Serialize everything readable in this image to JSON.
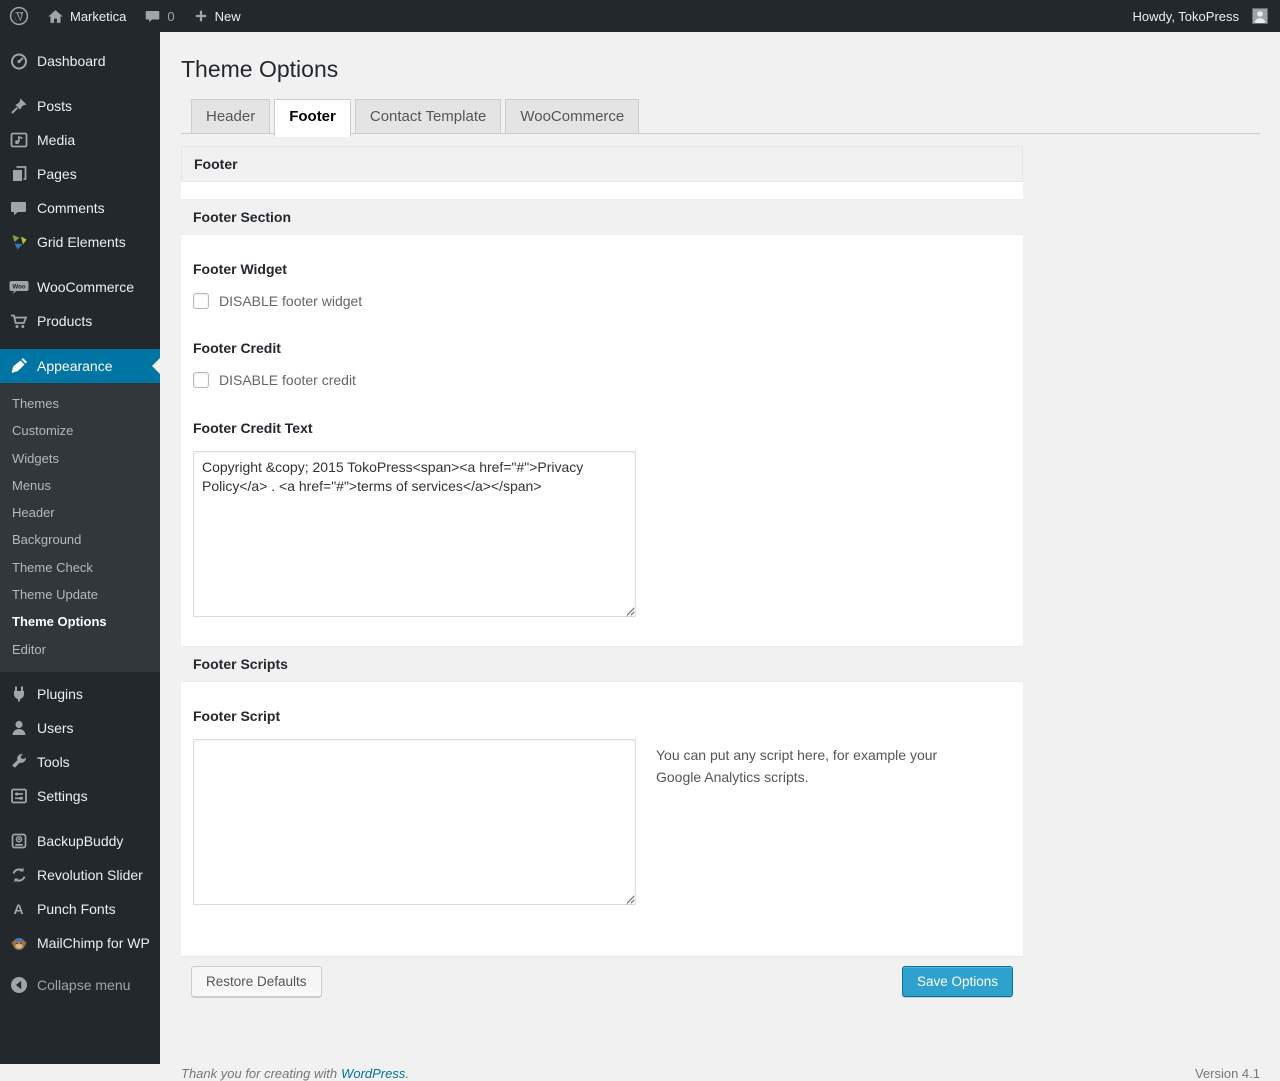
{
  "admin_bar": {
    "site_name": "Marketica",
    "comment_count": "0",
    "new_label": "New",
    "howdy_text": "Howdy, TokoPress"
  },
  "sidebar": {
    "items": [
      {
        "label": "Dashboard",
        "icon": "dashboard-icon"
      },
      {
        "label": "Posts",
        "icon": "pin-icon"
      },
      {
        "label": "Media",
        "icon": "media-icon"
      },
      {
        "label": "Pages",
        "icon": "pages-icon"
      },
      {
        "label": "Comments",
        "icon": "comments-icon"
      },
      {
        "label": "Grid Elements",
        "icon": "grid-elements-icon"
      },
      {
        "label": "WooCommerce",
        "icon": "woocommerce-icon"
      },
      {
        "label": "Products",
        "icon": "cart-icon"
      },
      {
        "label": "Appearance",
        "icon": "brush-icon",
        "active": true
      },
      {
        "label": "Plugins",
        "icon": "plugin-icon"
      },
      {
        "label": "Users",
        "icon": "user-icon"
      },
      {
        "label": "Tools",
        "icon": "wrench-icon"
      },
      {
        "label": "Settings",
        "icon": "settings-icon"
      },
      {
        "label": "BackupBuddy",
        "icon": "backup-icon"
      },
      {
        "label": "Revolution Slider",
        "icon": "refresh-icon"
      },
      {
        "label": "Punch Fonts",
        "icon": "font-a-icon"
      },
      {
        "label": "MailChimp for WP",
        "icon": "mailchimp-icon"
      },
      {
        "label": "Collapse menu",
        "icon": "collapse-icon"
      }
    ],
    "appearance_submenu": [
      {
        "label": "Themes"
      },
      {
        "label": "Customize"
      },
      {
        "label": "Widgets"
      },
      {
        "label": "Menus"
      },
      {
        "label": "Header"
      },
      {
        "label": "Background"
      },
      {
        "label": "Theme Check"
      },
      {
        "label": "Theme Update"
      },
      {
        "label": "Theme Options",
        "current": true
      },
      {
        "label": "Editor"
      }
    ]
  },
  "main": {
    "page_title": "Theme Options",
    "tabs": [
      {
        "label": "Header"
      },
      {
        "label": "Footer",
        "active": true
      },
      {
        "label": "Contact Template"
      },
      {
        "label": "WooCommerce"
      }
    ],
    "panel_title": "Footer",
    "sections": {
      "footer_section_title": "Footer Section",
      "footer_scripts_title": "Footer Scripts"
    },
    "fields": {
      "footer_widget_label": "Footer Widget",
      "footer_widget_checkbox_label": "DISABLE footer widget",
      "footer_credit_label": "Footer Credit",
      "footer_credit_checkbox_label": "DISABLE footer credit",
      "footer_credit_text_label": "Footer Credit Text",
      "footer_credit_text_value": "Copyright &copy; 2015 TokoPress<span><a href=\"#\">Privacy Policy</a> . <a href=\"#\">terms of services</a></span>",
      "footer_script_label": "Footer Script",
      "footer_script_value": "",
      "footer_script_description": "You can put any script here, for example your Google Analytics scripts."
    },
    "buttons": {
      "restore_label": "Restore Defaults",
      "save_label": "Save Options"
    }
  },
  "page_footer": {
    "thanks_text": "Thank you for creating with",
    "wordpress_link": "WordPress",
    "period": ".",
    "version": "Version 4.1"
  },
  "colors": {
    "accent_blue": "#0074a2",
    "button_primary": "#2ea2cc",
    "admin_bar_bg": "#23282d",
    "menu_bg": "#23282d",
    "submenu_bg": "#32373c",
    "page_bg": "#f1f1f1"
  }
}
